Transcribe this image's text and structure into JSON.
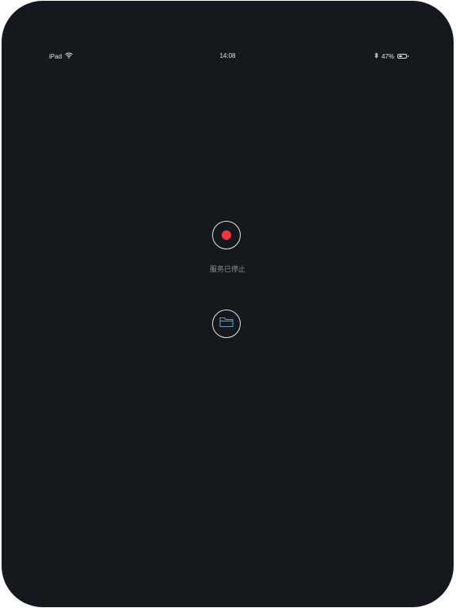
{
  "status_bar": {
    "device_label": "iPad",
    "time": "14:08",
    "battery_percent_label": "47%",
    "battery_level": 0.47,
    "icons": [
      "wifi-icon",
      "bluetooth-icon",
      "battery-icon"
    ]
  },
  "main": {
    "record_button": {
      "icon": "record-dot-icon",
      "dot_color": "#f0363f"
    },
    "service_status": "服务已停止",
    "files_button": {
      "icon": "folder-icon",
      "icon_color": "#5b9bd5"
    }
  },
  "colors": {
    "background": "#15181c",
    "button_ring": "#e8e8e8",
    "status_text": "#8f9398"
  }
}
